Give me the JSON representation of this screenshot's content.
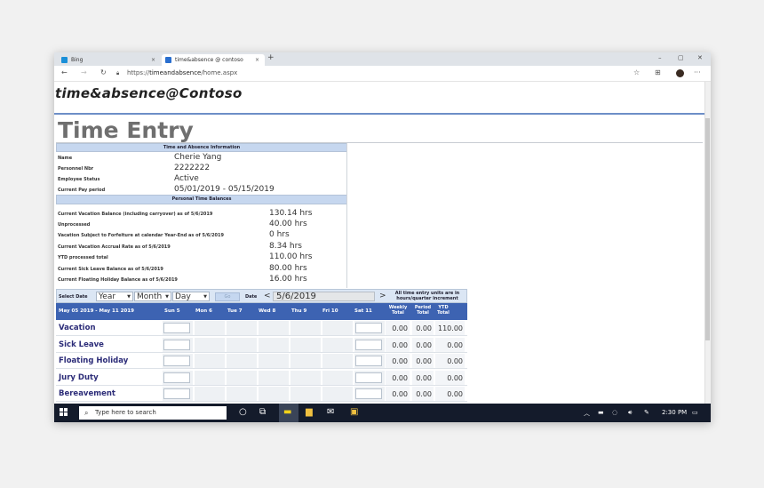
{
  "browser": {
    "tabs": [
      {
        "title": "Bing",
        "favicon_color": "#1a8fd8"
      },
      {
        "title": "time&absence @ contoso",
        "favicon_color": "#2a6fcf"
      }
    ],
    "url_prefix": "https://",
    "url_host": "timeandabsence",
    "url_path": "/home.aspx",
    "new_tab": "+",
    "tab_close": "×",
    "win_min": "–",
    "win_max": "▢",
    "win_close": "✕",
    "back": "←",
    "forward": "→",
    "refresh": "↻",
    "star": "☆",
    "collections": "⊞",
    "more": "···"
  },
  "site": {
    "logo": "time&absence@Contoso",
    "page_title": "Time Entry"
  },
  "info": {
    "header": "Time and Absence Information",
    "rows": [
      {
        "label": "Name",
        "value": "Cherie Yang"
      },
      {
        "label": "Personnel Nbr",
        "value": "2222222"
      },
      {
        "label": "Employee Status",
        "value": "Active"
      },
      {
        "label": "Current Pay period",
        "value": "05/01/2019 - 05/15/2019"
      }
    ]
  },
  "balances": {
    "header": "Personal Time Balances",
    "rows": [
      {
        "label": "Current Vacation Balance (including carryover) as of 5/6/2019",
        "value": "130.14 hrs"
      },
      {
        "label": "Unprocessed",
        "value": "40.00 hrs"
      },
      {
        "label": "Vacation Subject to Forfeiture at calendar Year-End as of 5/6/2019",
        "value": "0 hrs"
      },
      {
        "label": "Current Vacation Accrual Rate as of 5/6/2019",
        "value": "8.34 hrs"
      },
      {
        "label": "YTD processed total",
        "value": "110.00 hrs"
      },
      {
        "label": "Current Sick Leave Balance as of 5/6/2019",
        "value": "80.00 hrs"
      },
      {
        "label": "Current Floating Holiday Balance as of 5/6/2019",
        "value": "16.00 hrs"
      }
    ]
  },
  "selector": {
    "select_date_label": "Select Date",
    "year": "Year",
    "month": "Month",
    "day": "Day",
    "go": "Go",
    "date_label": "Date",
    "prev": "<",
    "next": ">",
    "date_value": "5/6/2019",
    "units_note": "All time entry units are in hours/quarter increment"
  },
  "table": {
    "week_label": "May 05 2019 - May 11 2019",
    "days": [
      "Sun 5",
      "Mon 6",
      "Tue 7",
      "Wed 8",
      "Thu 9",
      "Fri 10",
      "Sat 11"
    ],
    "totals_headers": [
      "Weekly Total",
      "Period Total",
      "YTD Total"
    ],
    "rows": [
      {
        "category": "Vacation",
        "weekly": "0.00",
        "period": "0.00",
        "ytd": "110.00"
      },
      {
        "category": "Sick Leave",
        "weekly": "0.00",
        "period": "0.00",
        "ytd": "0.00"
      },
      {
        "category": "Floating Holiday",
        "weekly": "0.00",
        "period": "0.00",
        "ytd": "0.00"
      },
      {
        "category": "Jury Duty",
        "weekly": "0.00",
        "period": "0.00",
        "ytd": "0.00"
      },
      {
        "category": "Bereavement",
        "weekly": "0.00",
        "period": "0.00",
        "ytd": "0.00"
      }
    ]
  },
  "taskbar": {
    "search_placeholder": "Type here to search",
    "clock": "2:30 PM"
  }
}
